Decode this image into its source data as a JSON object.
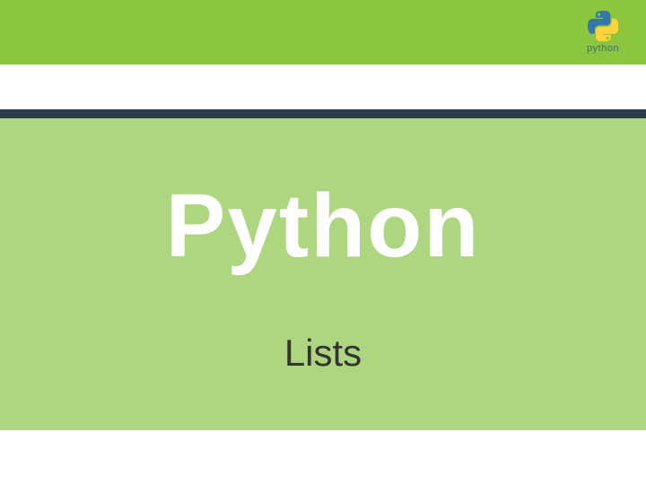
{
  "title": "Python",
  "subtitle": "Lists",
  "logo": {
    "label": "python"
  }
}
